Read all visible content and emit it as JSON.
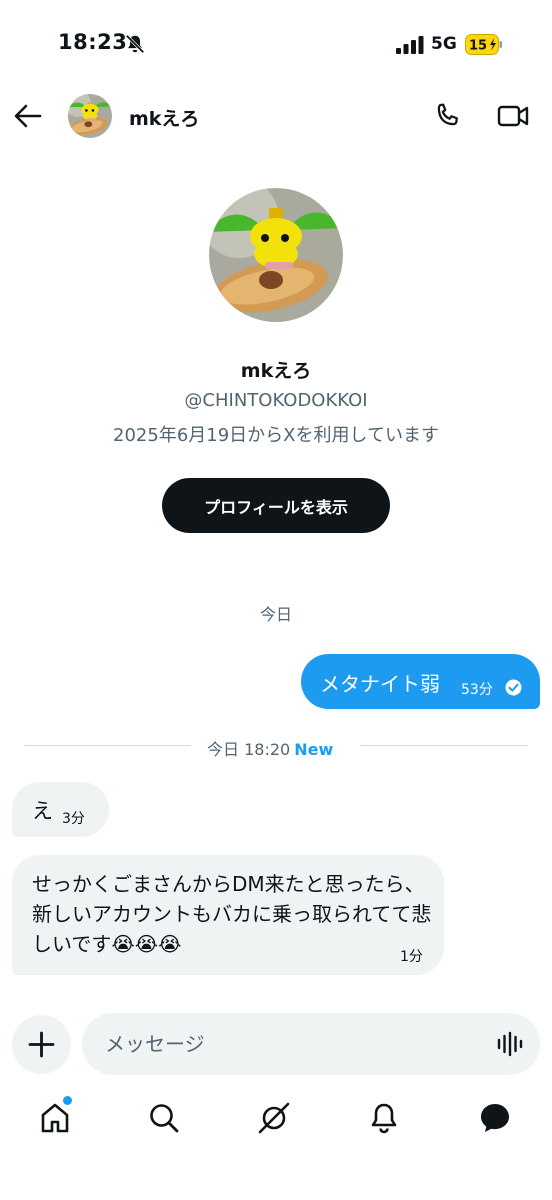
{
  "status_bar": {
    "time": "18:23",
    "network": "5G",
    "battery": "15"
  },
  "header": {
    "name": "mkえろ"
  },
  "profile": {
    "name": "mkえろ",
    "handle": "@CHINTOKODOKKOI",
    "joined": "2025年6月19日からXを利用しています",
    "button_label": "プロフィールを表示"
  },
  "conversation": {
    "date_label": "今日",
    "outgoing": {
      "text": "メタナイト弱",
      "time": "53分"
    },
    "divider": {
      "text": "今日 18:20",
      "new_label": "New"
    },
    "incoming": [
      {
        "text": "え",
        "time": "3分"
      },
      {
        "text": "せっかくごまさんからDM来たと思ったら、新しいアカウントもバカに乗っ取られてて悲しいです😭😭😭",
        "time": "1分"
      }
    ]
  },
  "composer": {
    "placeholder": "メッセージ"
  },
  "nav": {
    "items": [
      "home-icon",
      "search-icon",
      "grok-icon",
      "notifications-icon",
      "messages-icon"
    ],
    "home_has_dot": true
  },
  "colors": {
    "accent": "#1d9bf0",
    "text": "#0f1419",
    "muted": "#536471",
    "bubble_in": "#eff3f4",
    "battery": "#ffd60a"
  }
}
